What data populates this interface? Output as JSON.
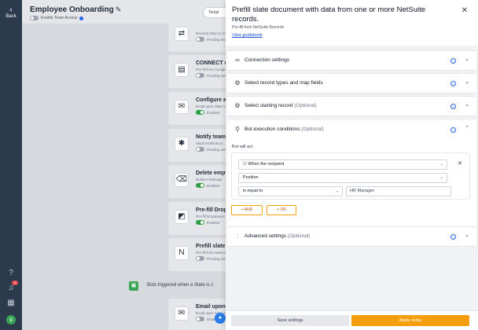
{
  "nav": {
    "back_label": "Back",
    "notification_count": "11",
    "avatar_initial": "g"
  },
  "header": {
    "title": "Employee Onboarding",
    "team_access_label": "Enable Team Access",
    "templates_label": "Templ"
  },
  "workflow": {
    "cards": [
      {
        "name": "",
        "sub": "Revised Step to Complete",
        "status": "Pending setup",
        "enabled": false,
        "icon": "sync-icon",
        "glyph": "⇄"
      },
      {
        "name": "CONNECT with your",
        "sub": "Pre-fill from Google Sheets",
        "status": "Pending setup",
        "enabled": false,
        "icon": "sheets-icon",
        "glyph": "▤"
      },
      {
        "name": "Configure and send",
        "sub": "Email upon Slate Opening",
        "status": "Enabled",
        "enabled": true,
        "icon": "email-icon",
        "glyph": "✉"
      },
      {
        "name": "Notify teammates i",
        "sub": "Slack Notification",
        "status": "Pending setup",
        "enabled": false,
        "icon": "slack-icon",
        "glyph": "✱"
      },
      {
        "name": "Delete empty field t",
        "sub": "Delete Fieldcage",
        "status": "Enabled",
        "enabled": true,
        "icon": "delete-field-icon",
        "glyph": "⌫"
      },
      {
        "name": "Pre-fill Dropdown F",
        "sub": "Pre-fill Dropdowns from D",
        "status": "Enabled",
        "enabled": true,
        "icon": "dropdown-icon",
        "glyph": "◩"
      },
      {
        "name": "Prefill slate docume",
        "sub": "Pre-fill from NetSuite Recor",
        "status": "Pending setup",
        "enabled": false,
        "icon": "netsuite-icon",
        "glyph": "N"
      },
      {
        "name": "Email upon Slate Co",
        "sub": "Email upon Slate Com",
        "status": "Disabled",
        "enabled": false,
        "icon": "email-icon",
        "glyph": "✉"
      }
    ],
    "bots_triggered_label": "Bots triggered when a Slate is c"
  },
  "panel": {
    "title": "Prefill slate document with data from one or more NetSuite records.",
    "subtitle": "Pre-fill from NetSuite Records",
    "guidebook_link": "View guidebook",
    "sections": {
      "connection": {
        "label": "Connection settings",
        "optional": ""
      },
      "record_types": {
        "label": "Select record types and map fields",
        "optional": ""
      },
      "starting_record": {
        "label": "Select starting record",
        "optional": "(Optional)"
      },
      "execution": {
        "label": "Bot execution conditions",
        "optional": "(Optional)"
      },
      "advanced": {
        "label": "Advanced settings",
        "optional": "(Optional)"
      }
    },
    "bot_will_act": "Bot will act",
    "condition": {
      "who": "When the recipient",
      "field": "Position",
      "operator": "is equal to",
      "value": "HR Manager"
    },
    "and_label": "AND",
    "or_label": "OR",
    "save_label": "Save settings",
    "apply_label": "Apply setup"
  },
  "colors": {
    "accent": "#f59e0b",
    "link": "#1d4ed8",
    "nav_bg": "#2b3a4d",
    "enabled_green": "#2ea043"
  }
}
